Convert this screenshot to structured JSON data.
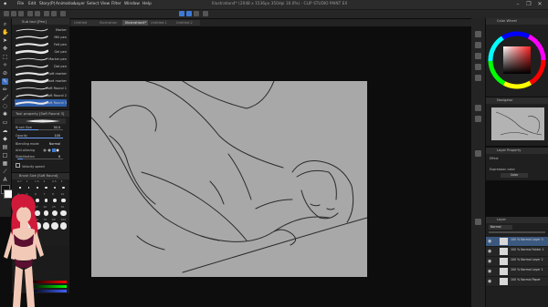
{
  "colors": {
    "accent": "#3d7ad6",
    "panel": "#1f1f1f",
    "canvas_bg": "#0d0d0d",
    "paper": "#a8a8a8"
  },
  "menubar": {
    "items": [
      "File",
      "Edit",
      "Story(P)",
      "Animation",
      "Layer",
      "Select",
      "View",
      "Filter",
      "Window",
      "Help"
    ],
    "title": "Illustration4* (2048 x 1536px 350dpi 16.0%) - CLIP STUDIO PAINT EX",
    "window_buttons": [
      "–",
      "❐",
      "✕"
    ]
  },
  "tabs": [
    "Untitled",
    "Illustration",
    "Illustration4*",
    "Untitled-1",
    "Untitled-2"
  ],
  "brush_panel": {
    "header": "Sub tool [Pen]",
    "brushes": [
      {
        "label": "Marker"
      },
      {
        "label": "Mill pen"
      },
      {
        "label": "Felt pen"
      },
      {
        "label": "Gel pen"
      },
      {
        "label": "Marker pen"
      },
      {
        "label": "Dot pen"
      },
      {
        "label": "Soft marker"
      },
      {
        "label": "Hard marker"
      },
      {
        "label": "Soft Round 1"
      },
      {
        "label": "Soft Round 2"
      },
      {
        "label": "Soft Round 3"
      }
    ]
  },
  "tool_property": {
    "header": "Tool property [Soft Round 3]",
    "rows": [
      {
        "label": "Brush Size",
        "value": "30.0",
        "level": 0.45
      },
      {
        "label": "Opacity",
        "value": "100",
        "level": 1.0
      },
      {
        "label": "Blending mode",
        "value": "Normal"
      },
      {
        "label": "Anti-aliasing",
        "value": ""
      },
      {
        "label": "Stabilization",
        "value": "6",
        "level": 0.12
      },
      {
        "label": "Velocity speed",
        "value": ""
      }
    ]
  },
  "size_panel": {
    "header": "Brush Size [Soft Round]",
    "labels": [
      "0.7",
      "1",
      "1.5",
      "2",
      "2.5",
      "3",
      "4",
      "5",
      "6",
      "7",
      "8",
      "10",
      "12",
      "15",
      "17",
      "20",
      "25",
      "30",
      "40",
      "50",
      "60",
      "70",
      "80",
      "100"
    ]
  },
  "right": {
    "color_wheel_header": "Color Wheel",
    "navigator_header": "Navigator",
    "layer_property_header": "Layer Property",
    "layer_property_effect": "Effect",
    "layer_property_expression": "Expression color",
    "layer_property_value": "Color",
    "layer_header": "Layer",
    "blend_mode": "Normal",
    "layers": [
      {
        "name": "100 % Normal Layer 3",
        "selected": true
      },
      {
        "name": "100 % Normal Folder 1",
        "selected": false
      },
      {
        "name": "100 % Normal Layer 2",
        "selected": false
      },
      {
        "name": "100 % Normal Layer 1",
        "selected": false
      },
      {
        "name": "100 % Normal Paper",
        "selected": false
      }
    ]
  }
}
